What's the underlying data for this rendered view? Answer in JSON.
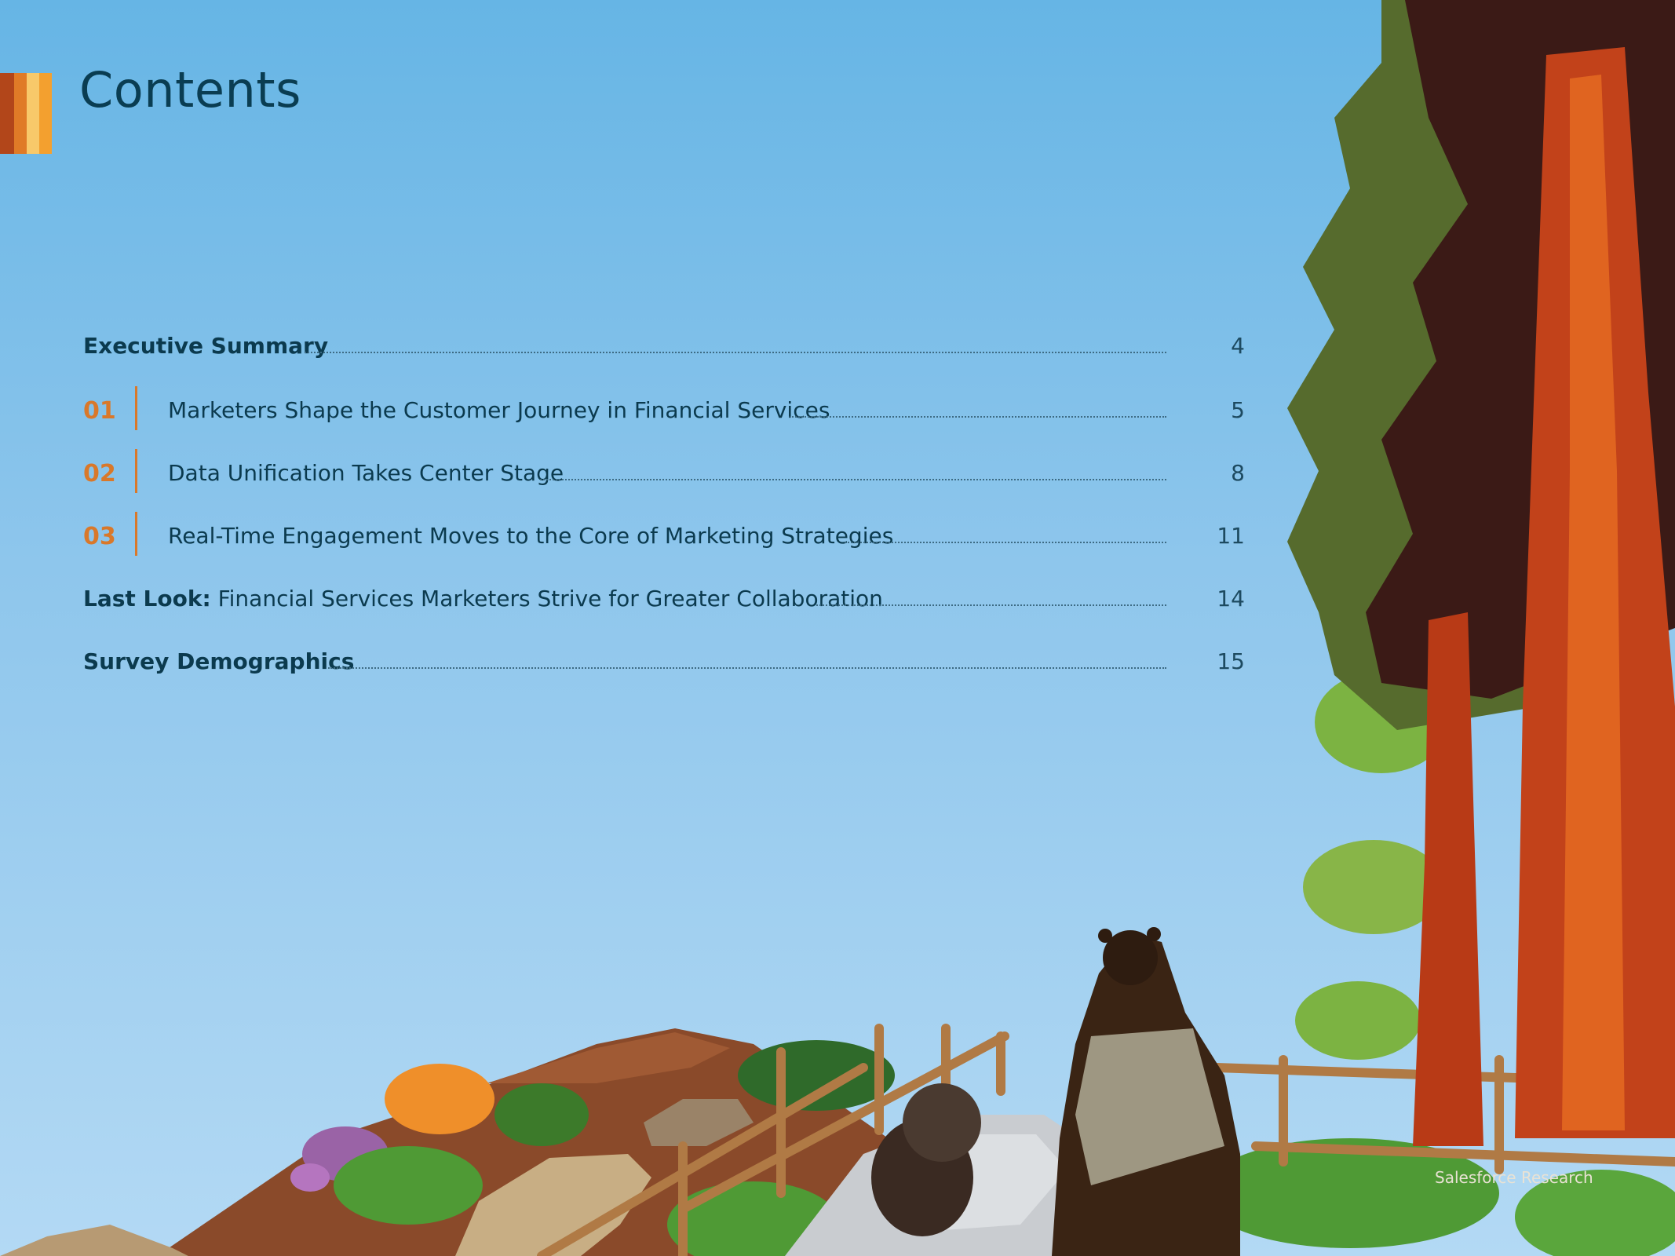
{
  "title": "Contents",
  "accent_colors": [
    "#b2461a",
    "#e07b27",
    "#f3a02f",
    "#f8c96a"
  ],
  "toc": [
    {
      "bold_label": "Executive Summary",
      "label": "",
      "number": "",
      "page": "4"
    },
    {
      "bold_label": "",
      "label": "Marketers Shape the Customer Journey in Financial Services",
      "number": "01",
      "page": "5"
    },
    {
      "bold_label": "",
      "label": "Data Unification Takes Center Stage",
      "number": "02",
      "page": "8"
    },
    {
      "bold_label": "",
      "label": "Real-Time Engagement Moves to the Core of Marketing Strategies",
      "number": "03",
      "page": "11"
    },
    {
      "bold_label": "Last Look:",
      "label": "Financial Services Marketers Strive for Greater Collaboration",
      "number": "",
      "page": "14"
    },
    {
      "bold_label": "Survey Demographics",
      "label": "",
      "number": "",
      "page": "15"
    }
  ],
  "footer": "Salesforce Research",
  "colors": {
    "section_number": "#d9782a",
    "title": "#0a3d52",
    "sky_top": "#66b5e5",
    "sky_bottom": "#b3d9f4"
  }
}
